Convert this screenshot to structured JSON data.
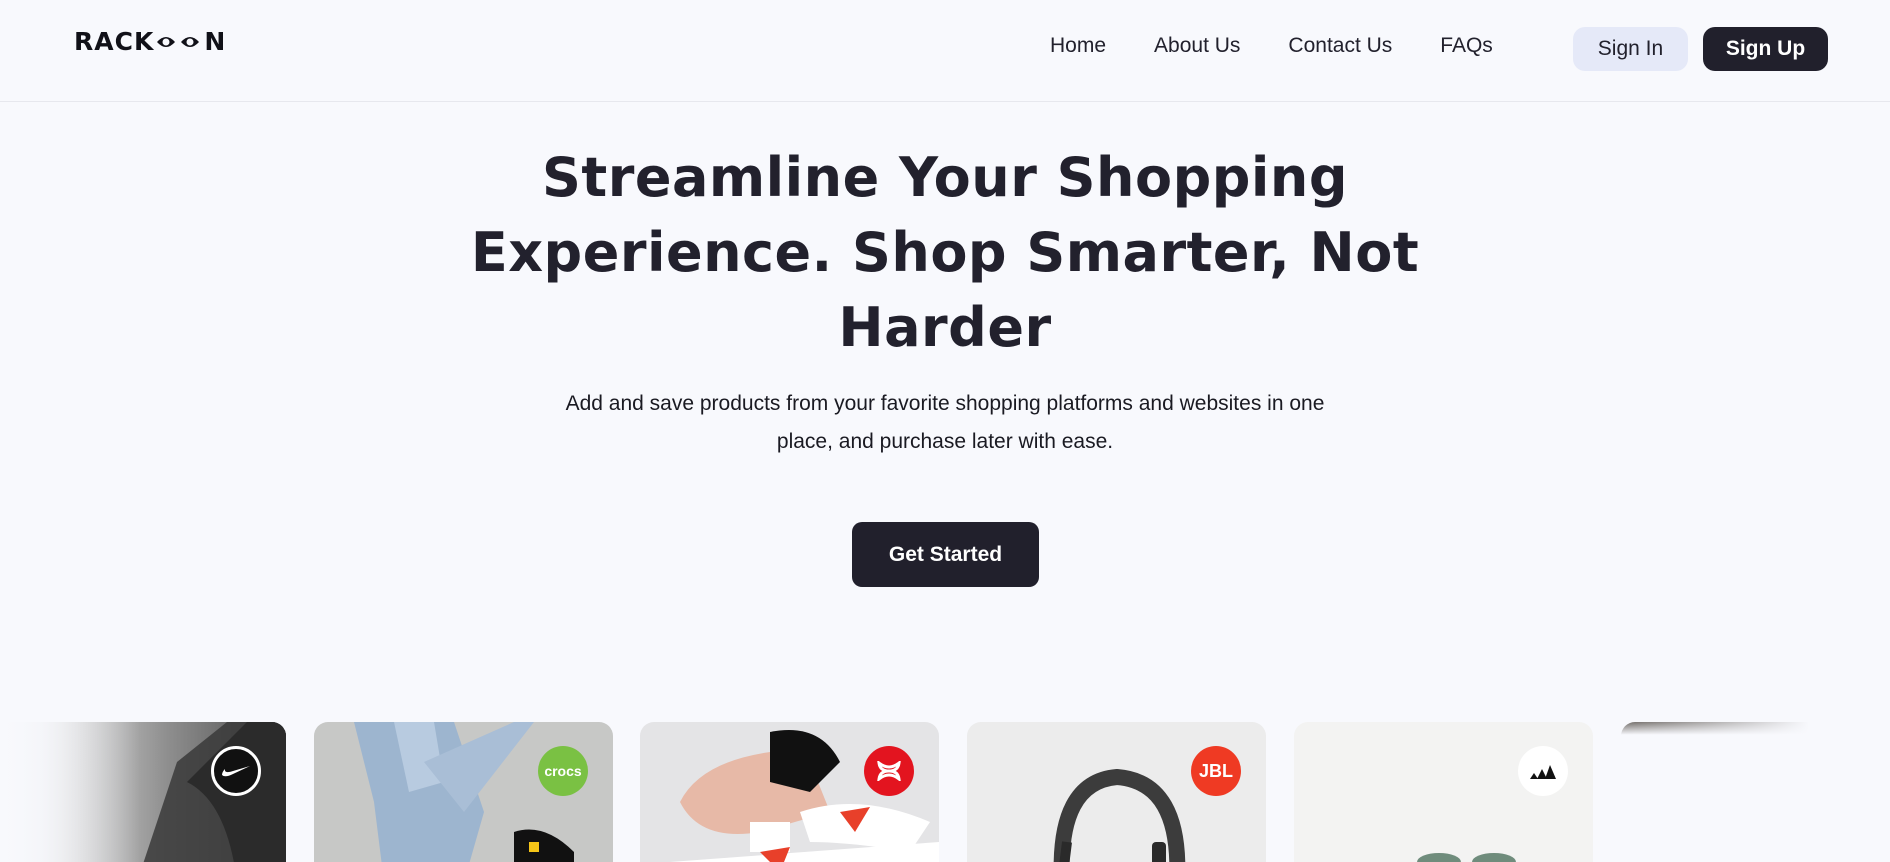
{
  "brand": {
    "logo_text_left": "RACK",
    "logo_text_right": "N"
  },
  "nav": {
    "items": [
      {
        "label": "Home"
      },
      {
        "label": "About Us"
      },
      {
        "label": "Contact Us"
      },
      {
        "label": "FAQs"
      }
    ],
    "sign_in_label": "Sign In",
    "sign_up_label": "Sign Up"
  },
  "hero": {
    "title": "Streamline Your Shopping Experience. Shop Smarter, Not Harder",
    "subtitle": "Add and save products from your favorite shopping platforms and websites in one place, and purchase later with ease.",
    "cta_label": "Get Started"
  },
  "carousel": {
    "cards": [
      {
        "brand": "Nike",
        "icon": "nike-swoosh-icon",
        "badge_bg": "#111111"
      },
      {
        "brand": "Crocs",
        "icon": "crocs-logo-icon",
        "badge_bg": "#7ac143",
        "badge_text": "crocs"
      },
      {
        "brand": "Under Armour",
        "icon": "under-armour-logo-icon",
        "badge_bg": "#e3141f"
      },
      {
        "brand": "JBL",
        "icon": "jbl-logo-icon",
        "badge_bg": "#ef3a23",
        "badge_text": "JBL"
      },
      {
        "brand": "Adidas",
        "icon": "adidas-logo-icon",
        "badge_bg": "#ffffff"
      },
      {
        "brand": "",
        "icon": "product-image",
        "badge_bg": ""
      }
    ]
  },
  "colors": {
    "background": "#f8f9fd",
    "primary_dark": "#21202c",
    "secondary_light": "#e5e9f8"
  }
}
